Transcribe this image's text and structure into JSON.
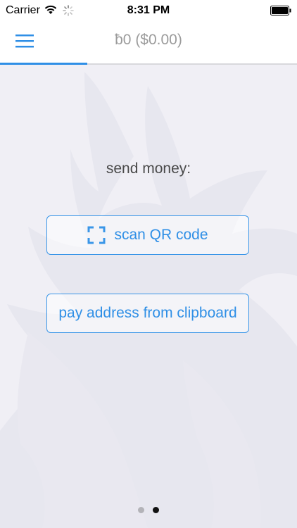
{
  "status_bar": {
    "carrier": "Carrier",
    "time": "8:31 PM"
  },
  "nav": {
    "balance": "ƀ0 ($0.00)",
    "menu_icon": "hamburger-menu-icon",
    "accent_color": "#2f8fe6"
  },
  "main": {
    "send_label": "send money:",
    "scan_button_label": "scan QR code",
    "scan_icon": "qr-scan-frame-icon",
    "paste_button_label": "pay address from clipboard"
  },
  "pager": {
    "page_count": 2,
    "current_page": 2
  },
  "colors": {
    "background": "#f0eff5",
    "button_text": "#2f8fe6",
    "label_text": "#4a4a4a",
    "balance_text": "#9b9b9b"
  }
}
